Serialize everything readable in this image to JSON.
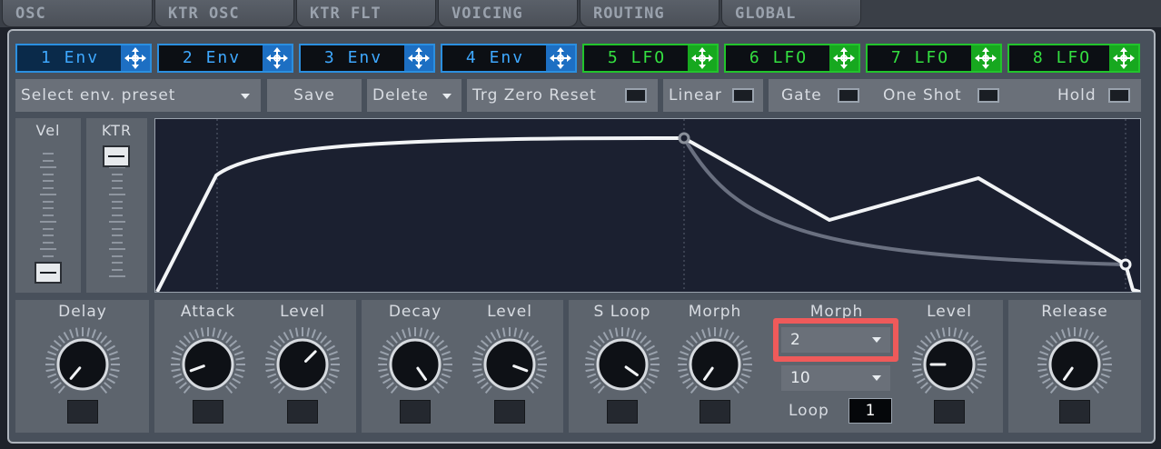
{
  "tabs": [
    "OSC",
    "KTR OSC",
    "KTR FLT",
    "VOICING",
    "ROUTING",
    "GLOBAL"
  ],
  "sources": [
    {
      "label": "1 Env",
      "active": true
    },
    {
      "label": "2 Env",
      "active": false
    },
    {
      "label": "3 Env",
      "active": false
    },
    {
      "label": "4 Env",
      "active": false
    },
    {
      "label": "5 LFO",
      "active": false
    },
    {
      "label": "6 LFO",
      "active": false
    },
    {
      "label": "7 LFO",
      "active": false
    },
    {
      "label": "8 LFO",
      "active": false
    }
  ],
  "toolbar": {
    "preset": "Select env. preset",
    "save": "Save",
    "delete": "Delete",
    "trg_zero_reset": "Trg Zero Reset",
    "linear": "Linear",
    "gate": "Gate",
    "one_shot": "One Shot",
    "hold": "Hold"
  },
  "sliders": {
    "vel": "Vel",
    "ktr": "KTR"
  },
  "knobs": {
    "delay": "Delay",
    "attack": "Attack",
    "attack_level": "Level",
    "decay": "Decay",
    "decay_level": "Level",
    "s_loop": "S Loop",
    "morph": "Morph",
    "morph_select_label": "Morph",
    "sustain_level": "Level",
    "release": "Release"
  },
  "morph_dropdowns": {
    "first": "2",
    "second": "10"
  },
  "loop": {
    "label": "Loop",
    "value": "1"
  },
  "colors": {
    "env_accent": "#3ea8ff",
    "lfo_accent": "#34e040",
    "highlight": "#ef5a5a"
  }
}
